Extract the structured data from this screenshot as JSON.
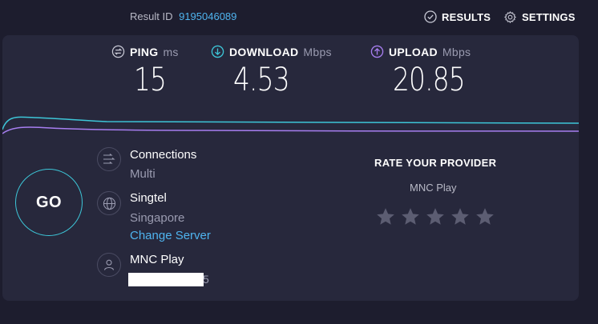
{
  "header": {
    "result_id_label": "Result ID",
    "result_id": "9195046089",
    "results_label": "RESULTS",
    "settings_label": "SETTINGS"
  },
  "metrics": {
    "ping": {
      "label": "PING",
      "unit": "ms",
      "value": "15"
    },
    "download": {
      "label": "DOWNLOAD",
      "unit": "Mbps",
      "value": "4.53"
    },
    "upload": {
      "label": "UPLOAD",
      "unit": "Mbps",
      "value": "20.85"
    }
  },
  "go_label": "GO",
  "connections": {
    "title": "Connections",
    "value": "Multi"
  },
  "server": {
    "name": "Singtel",
    "location": "Singapore",
    "change_label": "Change Server"
  },
  "provider": {
    "name": "MNC Play",
    "ip_tail": "5"
  },
  "rating": {
    "title": "RATE YOUR PROVIDER",
    "provider": "MNC Play",
    "star_count": 5,
    "selected": 0
  },
  "colors": {
    "background": "#1d1d2e",
    "panel": "#27283c",
    "accent_blue": "#4fb4ef",
    "download_cyan": "#3dc6d8",
    "upload_purple": "#a77ef0"
  },
  "icons": {
    "ping": "ping-icon",
    "download": "download-arrow-icon",
    "upload": "upload-arrow-icon",
    "connections": "connections-icon",
    "server": "globe-icon",
    "provider": "person-icon"
  }
}
